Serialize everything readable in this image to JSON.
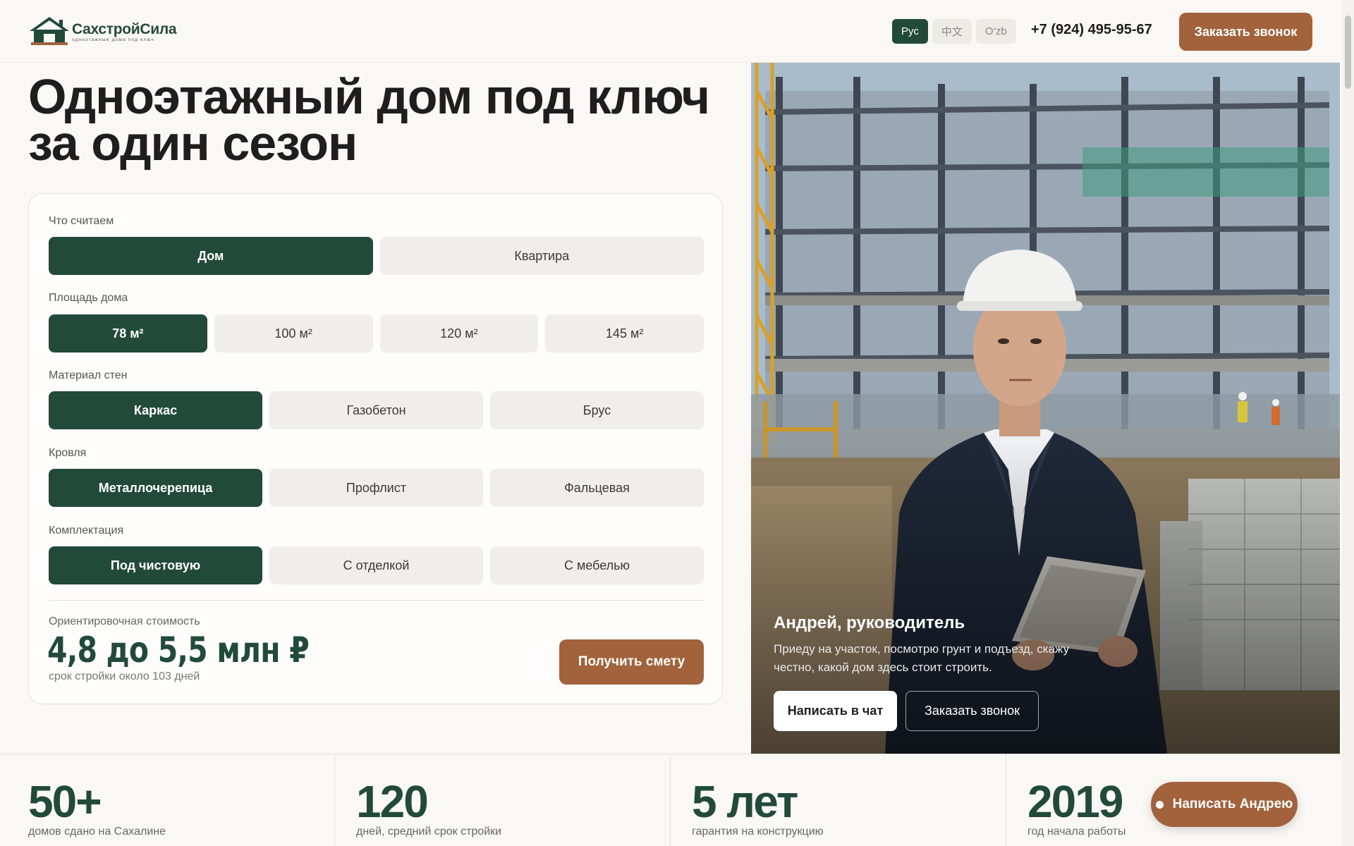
{
  "header": {
    "logo_name": "СахстройСила",
    "logo_tagline": "одноэтажные дома под ключ",
    "languages": [
      "Рус",
      "中文",
      "O‘zb"
    ],
    "active_language": "Рус",
    "phone": "+7 (924) 495-95-67",
    "call_button": "Заказать звонок"
  },
  "hero": {
    "title": "Одноэтажный дом под ключ за один сезон"
  },
  "calculator": {
    "groups": [
      {
        "label": "Что считаем",
        "options": [
          "Дом",
          "Квартира"
        ],
        "selected": "Дом"
      },
      {
        "label": "Площадь дома",
        "options": [
          "78 м²",
          "100 м²",
          "120 м²",
          "145 м²"
        ],
        "selected": "78 м²"
      },
      {
        "label": "Материал стен",
        "options": [
          "Каркас",
          "Газобетон",
          "Брус"
        ],
        "selected": "Каркас"
      },
      {
        "label": "Кровля",
        "options": [
          "Металлочерепица",
          "Профлист",
          "Фальцевая"
        ],
        "selected": "Металлочерепица"
      },
      {
        "label": "Комплектация",
        "options": [
          "Под чистовую",
          "С отделкой",
          "С мебелью"
        ],
        "selected": "Под чистовую"
      }
    ],
    "cost_label": "Ориентировочная стоимость",
    "cost_value": "4,8 до 5,5 млн ₽",
    "cost_note": "срок стройки около 103 дней",
    "estimate_button": "Получить смету"
  },
  "person": {
    "name": "Андрей, руководитель",
    "description": "Приеду на участок, посмотрю грунт и подъезд, скажу честно, какой дом здесь стоит строить.",
    "chat_button": "Написать в чат",
    "call_button": "Заказать звонок"
  },
  "stats": [
    {
      "value": "50+",
      "label": "домов сдано на Сахалине"
    },
    {
      "value": "120",
      "label": "дней, средний срок стройки"
    },
    {
      "value": "5 лет",
      "label": "гарантия на конструкцию"
    },
    {
      "value": "2019",
      "label": "год начала работы"
    }
  ],
  "floating_button": "Написать Андрею",
  "colors": {
    "primary": "#224a3a",
    "accent": "#a1623c",
    "background": "#faf8f4"
  }
}
